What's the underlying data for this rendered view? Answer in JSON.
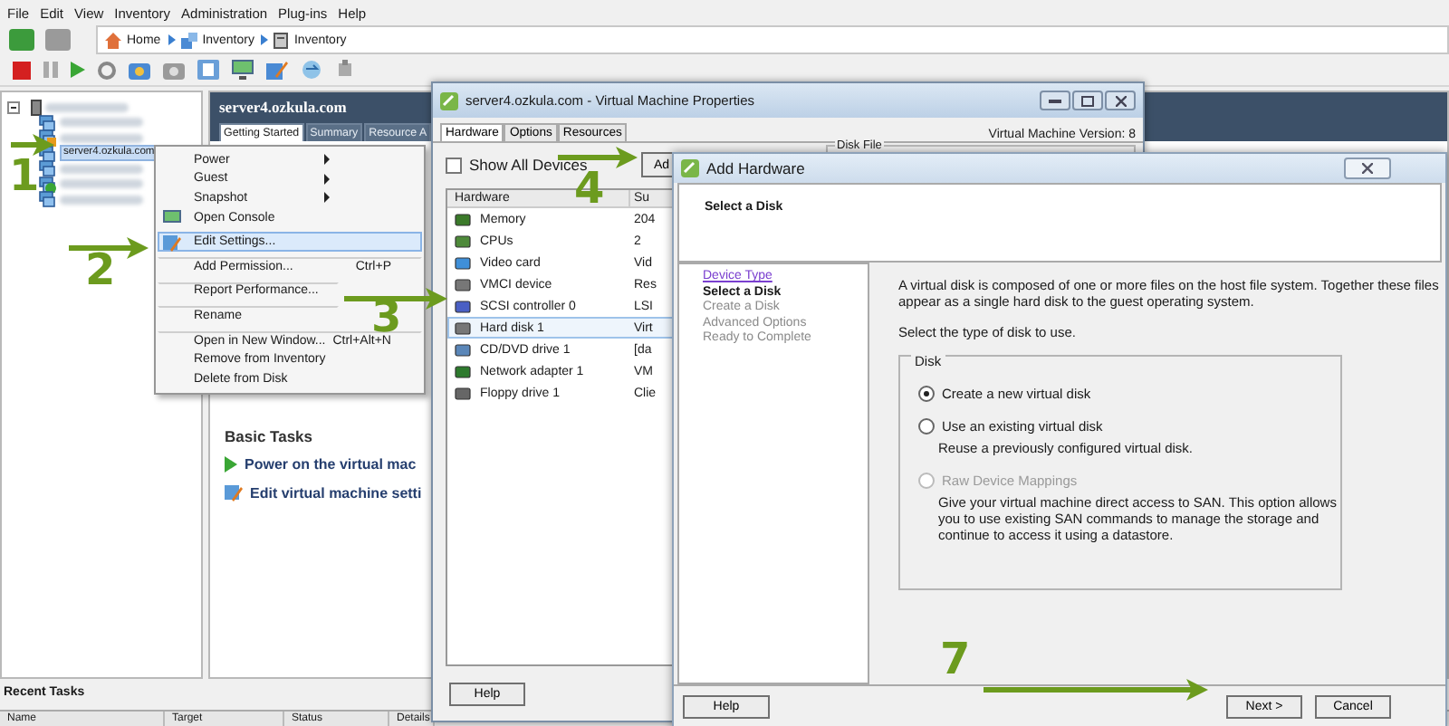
{
  "menu_bar": [
    "File",
    "Edit",
    "View",
    "Inventory",
    "Administration",
    "Plug-ins",
    "Help"
  ],
  "address_bar": {
    "crumbs": [
      {
        "label": "Home",
        "kind": "home"
      },
      {
        "label": "Inventory",
        "kind": "inventory"
      },
      {
        "label": "Inventory",
        "kind": "host"
      }
    ]
  },
  "inventory_tree": {
    "items": [
      {
        "kind": "host",
        "selected": false
      },
      {
        "kind": "vm",
        "selected": false
      },
      {
        "kind": "vm-warn",
        "selected": false
      },
      {
        "kind": "vm",
        "label": "server4.ozkula.com",
        "selected": true
      },
      {
        "kind": "vm",
        "selected": false
      },
      {
        "kind": "vm-on",
        "selected": false
      },
      {
        "kind": "vm",
        "selected": false
      }
    ]
  },
  "vm_panel": {
    "title": "server4.ozkula.com",
    "tabs": [
      {
        "label": "Getting Started",
        "selected": true
      },
      {
        "label": "Summary",
        "selected": false
      },
      {
        "label": "Resource A",
        "selected": false
      }
    ],
    "basic_tasks": {
      "heading": "Basic Tasks",
      "links": [
        {
          "label": "Power on the virtual mac",
          "kind": "power"
        },
        {
          "label": "Edit virtual machine setti",
          "kind": "edit"
        }
      ]
    }
  },
  "context_menu": {
    "items": [
      {
        "label": "Power",
        "submenu": true,
        "selected": false,
        "separator_before": false,
        "kind": "plain"
      },
      {
        "label": "Guest",
        "submenu": true,
        "selected": false,
        "separator_before": false,
        "kind": "plain"
      },
      {
        "label": "Snapshot",
        "submenu": true,
        "selected": false,
        "separator_before": false,
        "kind": "plain"
      },
      {
        "label": "Open Console",
        "submenu": false,
        "selected": false,
        "separator_before": false,
        "kind": "console"
      },
      {
        "label": "Edit Settings...",
        "submenu": false,
        "selected": true,
        "separator_before": true,
        "kind": "edit"
      },
      {
        "label": "Add Permission...",
        "shortcut": "Ctrl+P",
        "submenu": false,
        "selected": false,
        "separator_before": true,
        "kind": "plain"
      },
      {
        "label": "Report Performance...",
        "submenu": false,
        "selected": false,
        "separator_before": true,
        "kind": "plain"
      },
      {
        "label": "Rename",
        "submenu": false,
        "selected": false,
        "separator_before": true,
        "kind": "plain"
      },
      {
        "label": "Open in New Window...",
        "shortcut": "Ctrl+Alt+N",
        "submenu": false,
        "selected": false,
        "separator_before": true,
        "kind": "plain"
      },
      {
        "label": "Remove from Inventory",
        "submenu": false,
        "selected": false,
        "separator_before": false,
        "kind": "plain"
      },
      {
        "label": "Delete from Disk",
        "submenu": false,
        "selected": false,
        "separator_before": false,
        "kind": "plain"
      }
    ]
  },
  "recent_tasks": {
    "title": "Recent Tasks",
    "columns": [
      "Name",
      "Target",
      "Status",
      "Details"
    ]
  },
  "vm_properties": {
    "title": "server4.ozkula.com - Virtual Machine Properties",
    "tabs": [
      {
        "label": "Hardware",
        "selected": true
      },
      {
        "label": "Options",
        "selected": false
      },
      {
        "label": "Resources",
        "selected": false
      }
    ],
    "version": "Virtual Machine Version: 8",
    "show_all_devices": {
      "label": "Show All Devices",
      "checked": false
    },
    "add_button": "Ad",
    "disk_file_label": "Disk File",
    "hardware_table": {
      "columns": [
        "Hardware",
        "Su"
      ],
      "rows": [
        {
          "name": "Memory",
          "summary": "204",
          "kind": "memory",
          "selected": false
        },
        {
          "name": "CPUs",
          "summary": "2",
          "kind": "cpu",
          "selected": false
        },
        {
          "name": "Video card",
          "summary": "Vid",
          "kind": "video",
          "selected": false
        },
        {
          "name": "VMCI device",
          "summary": "Res",
          "kind": "device",
          "selected": false
        },
        {
          "name": "SCSI controller 0",
          "summary": "LSI",
          "kind": "scsi",
          "selected": false
        },
        {
          "name": "Hard disk 1",
          "summary": "Virt",
          "kind": "device",
          "selected": true
        },
        {
          "name": "CD/DVD drive 1",
          "summary": "[da",
          "kind": "cdrom",
          "selected": false
        },
        {
          "name": "Network adapter 1",
          "summary": "VM",
          "kind": "network",
          "selected": false
        },
        {
          "name": "Floppy drive 1",
          "summary": "Clie",
          "kind": "floppy",
          "selected": false
        }
      ]
    },
    "help_button": "Help"
  },
  "add_hardware": {
    "title": "Add Hardware",
    "heading": "Select a Disk",
    "steps": [
      {
        "label": "Device Type",
        "selected": false,
        "disabled": false
      },
      {
        "label": "Select a Disk",
        "selected": true,
        "disabled": false
      },
      {
        "label": "Create a Disk",
        "selected": false,
        "disabled": true
      },
      {
        "label": "Advanced Options",
        "selected": false,
        "disabled": true
      },
      {
        "label": "Ready to Complete",
        "selected": false,
        "disabled": true
      }
    ],
    "description": "A virtual disk is composed of one or more files on the host file system. Together these files appear as a single hard disk to the guest operating system.",
    "prompt": "Select the type of disk to use.",
    "group_label": "Disk",
    "options": [
      {
        "label": "Create a new virtual disk",
        "selected": true,
        "disabled": false
      },
      {
        "label": "Use an existing virtual disk",
        "description": "Reuse a previously configured virtual disk.",
        "selected": false,
        "disabled": false
      },
      {
        "label": "Raw Device Mappings",
        "description": "Give your virtual machine direct access to SAN. This option allows you to use existing SAN commands to manage the storage and continue to access it using a datastore.",
        "selected": false,
        "disabled": true
      }
    ],
    "help_button": "Help",
    "buttons": [
      "Next >",
      "Cancel"
    ]
  },
  "annotations": [
    {
      "number": "1"
    },
    {
      "number": "2"
    },
    {
      "number": "3"
    },
    {
      "number": "4"
    },
    {
      "number": "7"
    }
  ]
}
